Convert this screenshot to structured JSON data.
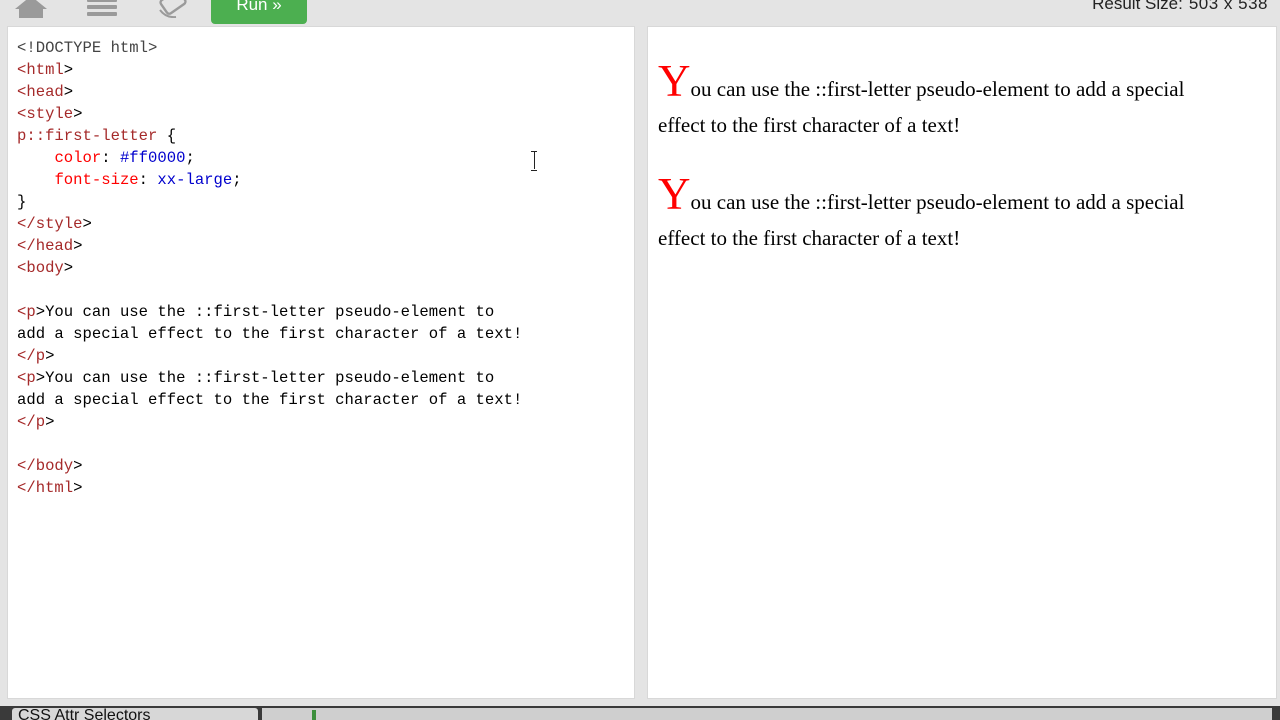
{
  "toolbar": {
    "icons": [
      "home-icon",
      "menu-icon",
      "rotate-icon"
    ],
    "run_label": "Run »",
    "result_size_label": "Result Size:",
    "result_size_value": "503 x 538"
  },
  "editor": {
    "lines": [
      "<!DOCTYPE html>",
      "<html>",
      "<head>",
      "<style>",
      "p::first-letter {",
      "    color: #ff0000;",
      "    font-size: xx-large;",
      "}",
      "</style>",
      "</head>",
      "<body>",
      "",
      "<p>You can use the ::first-letter pseudo-element to",
      "add a special effect to the first character of a text!",
      "</p>",
      "<p>You can use the ::first-letter pseudo-element to",
      "add a special effect to the first character of a text!",
      "</p>",
      "",
      "</body>",
      "</html>"
    ]
  },
  "result": {
    "paragraphs": [
      {
        "first": "Y",
        "rest": "ou can use the ::first-letter pseudo-element to add a special effect to the first character of a text!"
      },
      {
        "first": "Y",
        "rest": "ou can use the ::first-letter pseudo-element to add a special effect to the first character of a text!"
      }
    ]
  },
  "bottom": {
    "tab_label": "CSS Attr Selectors"
  },
  "colors": {
    "run_button": "#4caf50",
    "first_letter": "#ff0000",
    "tag": "#a52a2a",
    "property": "#ff0000",
    "value": "#0000cd"
  }
}
